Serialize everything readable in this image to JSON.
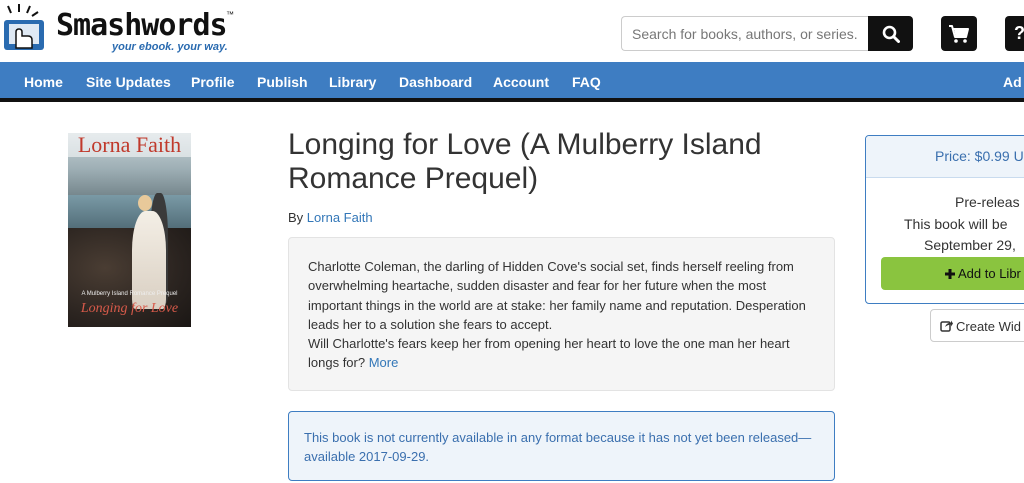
{
  "header": {
    "logo_text": "Smashwords",
    "logo_tm": "™",
    "tagline": "your ebook. your way.",
    "search_placeholder": "Search for books, authors, or series.",
    "help_label": "?"
  },
  "nav": {
    "items": [
      "Home",
      "Site Updates",
      "Profile",
      "Publish",
      "Library",
      "Dashboard",
      "Account",
      "FAQ"
    ],
    "right_item": "Ad"
  },
  "cover": {
    "author": "Lorna Faith",
    "title": "Longing for Love",
    "subtitle": "A Mulberry Island Romance Prequel"
  },
  "book": {
    "title": "Longing for Love (A Mulberry Island Romance Prequel)",
    "by_prefix": "By",
    "author": "Lorna Faith",
    "description_p1": "Charlotte Coleman, the darling of Hidden Cove's social set, finds herself reeling from overwhelming heartache, sudden disaster and fear for her future when the most important things in the world are at stake: her family name and reputation. Desperation leads her to a solution she fears to accept.",
    "description_p2": "Will Charlotte's fears keep her from opening her heart to love the one man her heart longs for?",
    "more_label": "More",
    "availability_notice": "This book is not currently available in any format because it has not yet been released—available 2017-09-29."
  },
  "sidebar": {
    "price": "Price: $0.99 U",
    "pre_release": "Pre-releas",
    "release_line1": "This book will be",
    "release_line2": "September 29,",
    "add_library_label": "Add to Libr",
    "create_widget_label": "Create Wid"
  },
  "colors": {
    "nav_blue": "#3e7dc2",
    "link_blue": "#3377b8",
    "add_green": "#8ac43f"
  }
}
